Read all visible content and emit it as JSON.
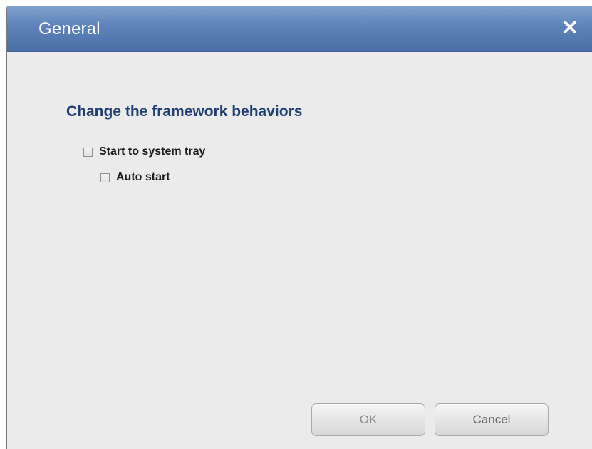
{
  "dialog": {
    "title": "General",
    "close_icon": "close-icon"
  },
  "content": {
    "heading": "Change the framework behaviors",
    "options": [
      {
        "label": "Start to system tray",
        "checked": false
      },
      {
        "label": "Auto start",
        "checked": false
      }
    ]
  },
  "buttons": {
    "ok_label": "OK",
    "ok_enabled": false,
    "cancel_label": "Cancel"
  },
  "colors": {
    "titlebar": "#5d82ba",
    "heading": "#1f3f73",
    "background": "#ebebeb"
  }
}
